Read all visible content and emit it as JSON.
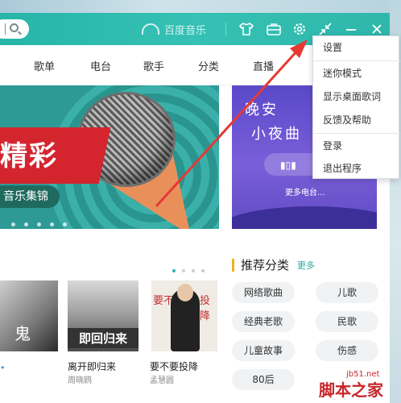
{
  "titlebar": {
    "brand": "百度音乐",
    "icons": [
      "search-icon",
      "skin-icon",
      "toolbox-icon",
      "gear-icon",
      "mini-mode-icon",
      "minimize-icon",
      "close-icon"
    ]
  },
  "nav": {
    "items": [
      "歌单",
      "电台",
      "歌手",
      "分类",
      "直播"
    ]
  },
  "banner": {
    "big_text": "精彩",
    "sub_text": "音乐集锦"
  },
  "right_banner": {
    "line1": "晚安",
    "line2": "小夜曲",
    "more": "更多电台..."
  },
  "songs": [
    {
      "title": "",
      "artist": "",
      "cover_text": "鬼"
    },
    {
      "title": "离开即归来",
      "artist": "周晓鸥",
      "cover_text": "即回归来"
    },
    {
      "title": "要不要投降",
      "artist": "孟慧圆",
      "cover_text": "要 不 要 投 降"
    }
  ],
  "recommended": {
    "title": "推荐分类",
    "more": "更多",
    "categories": [
      "网络歌曲",
      "儿歌",
      "经典老歌",
      "民歌",
      "儿童故事",
      "伤感",
      "80后"
    ]
  },
  "menu": {
    "items": [
      "设置",
      "迷你模式",
      "显示桌面歌词",
      "反馈及帮助",
      "登录",
      "退出程序"
    ]
  },
  "watermark": {
    "url": "jb51.net",
    "text": "脚本之家"
  },
  "colors": {
    "accent": "#2fb7ab",
    "arrow": "#e53935",
    "watermark": "#c8262a"
  }
}
